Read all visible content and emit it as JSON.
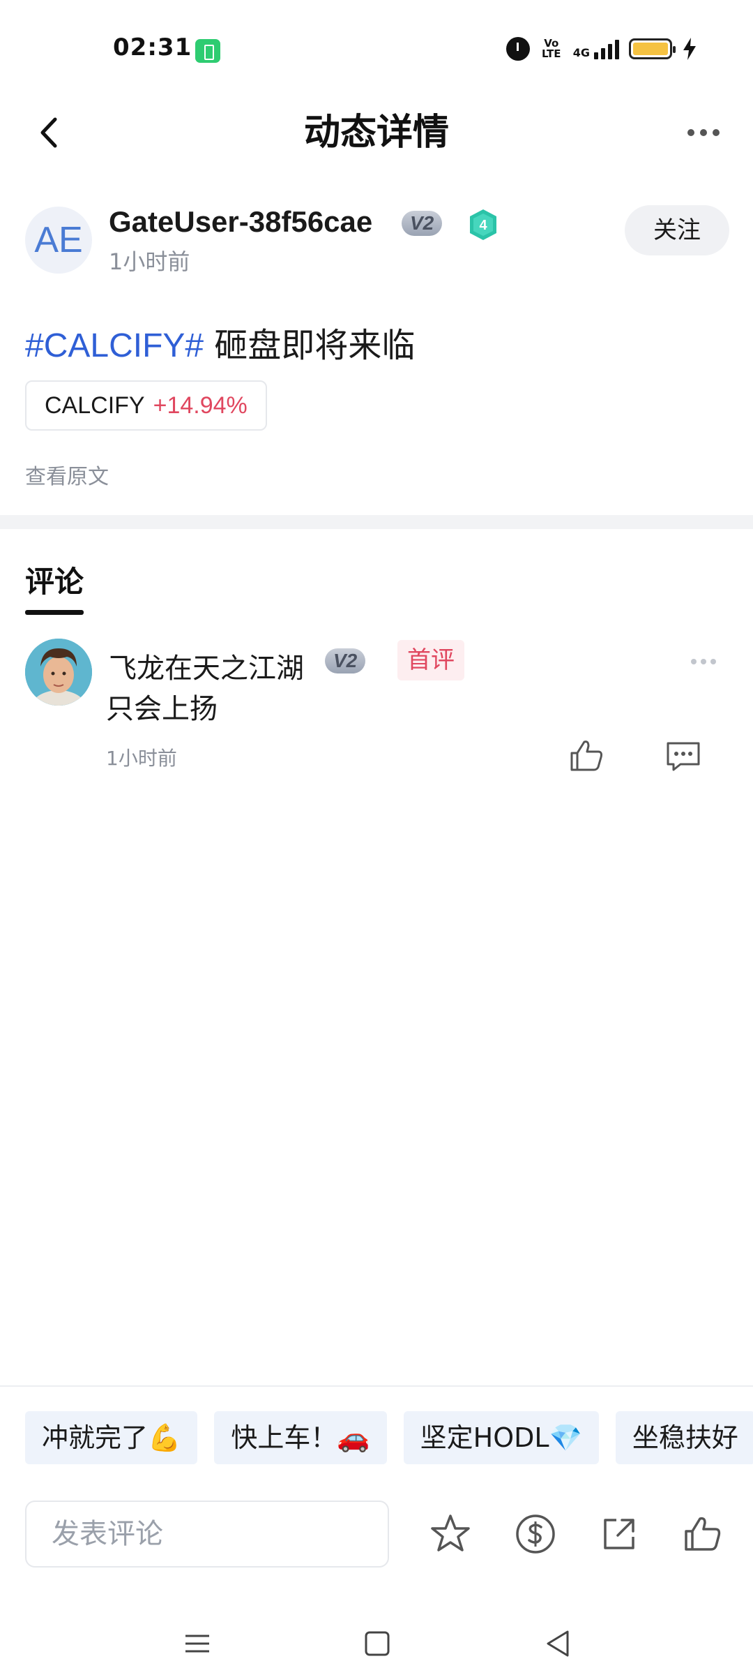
{
  "status_bar": {
    "time": "02:31",
    "network": "4G",
    "volte": "Vo LTE"
  },
  "nav": {
    "title": "动态详情"
  },
  "author": {
    "avatar_initials": "AE",
    "name": "GateUser-38f56cae",
    "vip_badge": "V2",
    "level": "4",
    "time": "1小时前",
    "follow_label": "关注"
  },
  "post": {
    "hashtag": "#CALCIFY#",
    "text": " 砸盘即将来临",
    "coin": {
      "name": "CALCIFY",
      "change": "+14.94%"
    },
    "view_original": "查看原文"
  },
  "comments_tab": {
    "label": "评论"
  },
  "comments": [
    {
      "user": "飞龙在天之江湖",
      "vip_badge": "V2",
      "first_badge": "首评",
      "text": "只会上扬",
      "time": "1小时前"
    }
  ],
  "quick_replies": [
    "冲就完了💪",
    "快上车！🚗",
    "坚定HODL💎",
    "坐稳扶好"
  ],
  "input": {
    "placeholder": "发表评论"
  },
  "colors": {
    "hashtag": "#2f5fd6",
    "positive_change": "#e0475f",
    "first_badge_bg": "#fdeef0",
    "chip_bg": "#eef3fb"
  },
  "icons": {
    "back": "chevron-left-icon",
    "more": "more-horizontal-icon",
    "like": "thumbs-up-icon",
    "reply": "comment-icon",
    "favorite": "star-icon",
    "tip": "coin-icon",
    "share": "share-icon"
  }
}
